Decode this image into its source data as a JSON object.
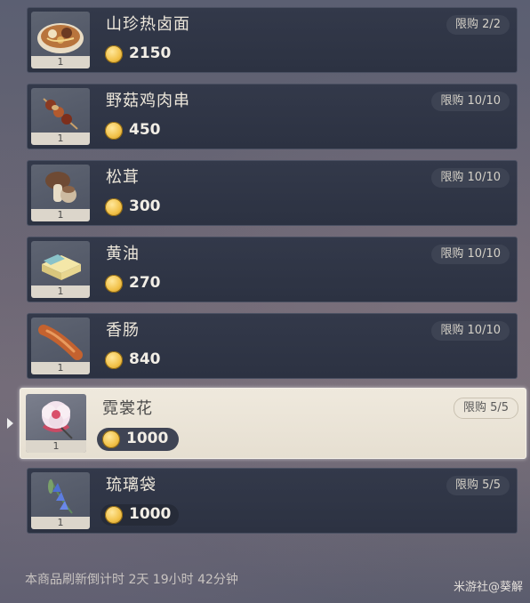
{
  "shop": {
    "items": [
      {
        "name": "山珍热卤面",
        "price": "2150",
        "limit": "限购 2/2",
        "qty": "1",
        "icon": "noodle-bowl-icon"
      },
      {
        "name": "野菇鸡肉串",
        "price": "450",
        "limit": "限购 10/10",
        "qty": "1",
        "icon": "skewer-icon"
      },
      {
        "name": "松茸",
        "price": "300",
        "limit": "限购 10/10",
        "qty": "1",
        "icon": "matsutake-icon"
      },
      {
        "name": "黄油",
        "price": "270",
        "limit": "限购 10/10",
        "qty": "1",
        "icon": "butter-icon"
      },
      {
        "name": "香肠",
        "price": "840",
        "limit": "限购 10/10",
        "qty": "1",
        "icon": "sausage-icon"
      },
      {
        "name": "霓裳花",
        "price": "1000",
        "limit": "限购 5/5",
        "qty": "1",
        "icon": "silk-flower-icon"
      },
      {
        "name": "琉璃袋",
        "price": "1000",
        "limit": "限购 5/5",
        "qty": "1",
        "icon": "glaze-lily-icon"
      }
    ],
    "selected_index": 5,
    "footer": "本商品刷新倒计时 2天 19小时 42分钟",
    "watermark": "米游社@葵解",
    "colors": {
      "row_bg": "#2f3545",
      "selected_bg": "#ece6da",
      "coin": "#f2c24a"
    }
  }
}
